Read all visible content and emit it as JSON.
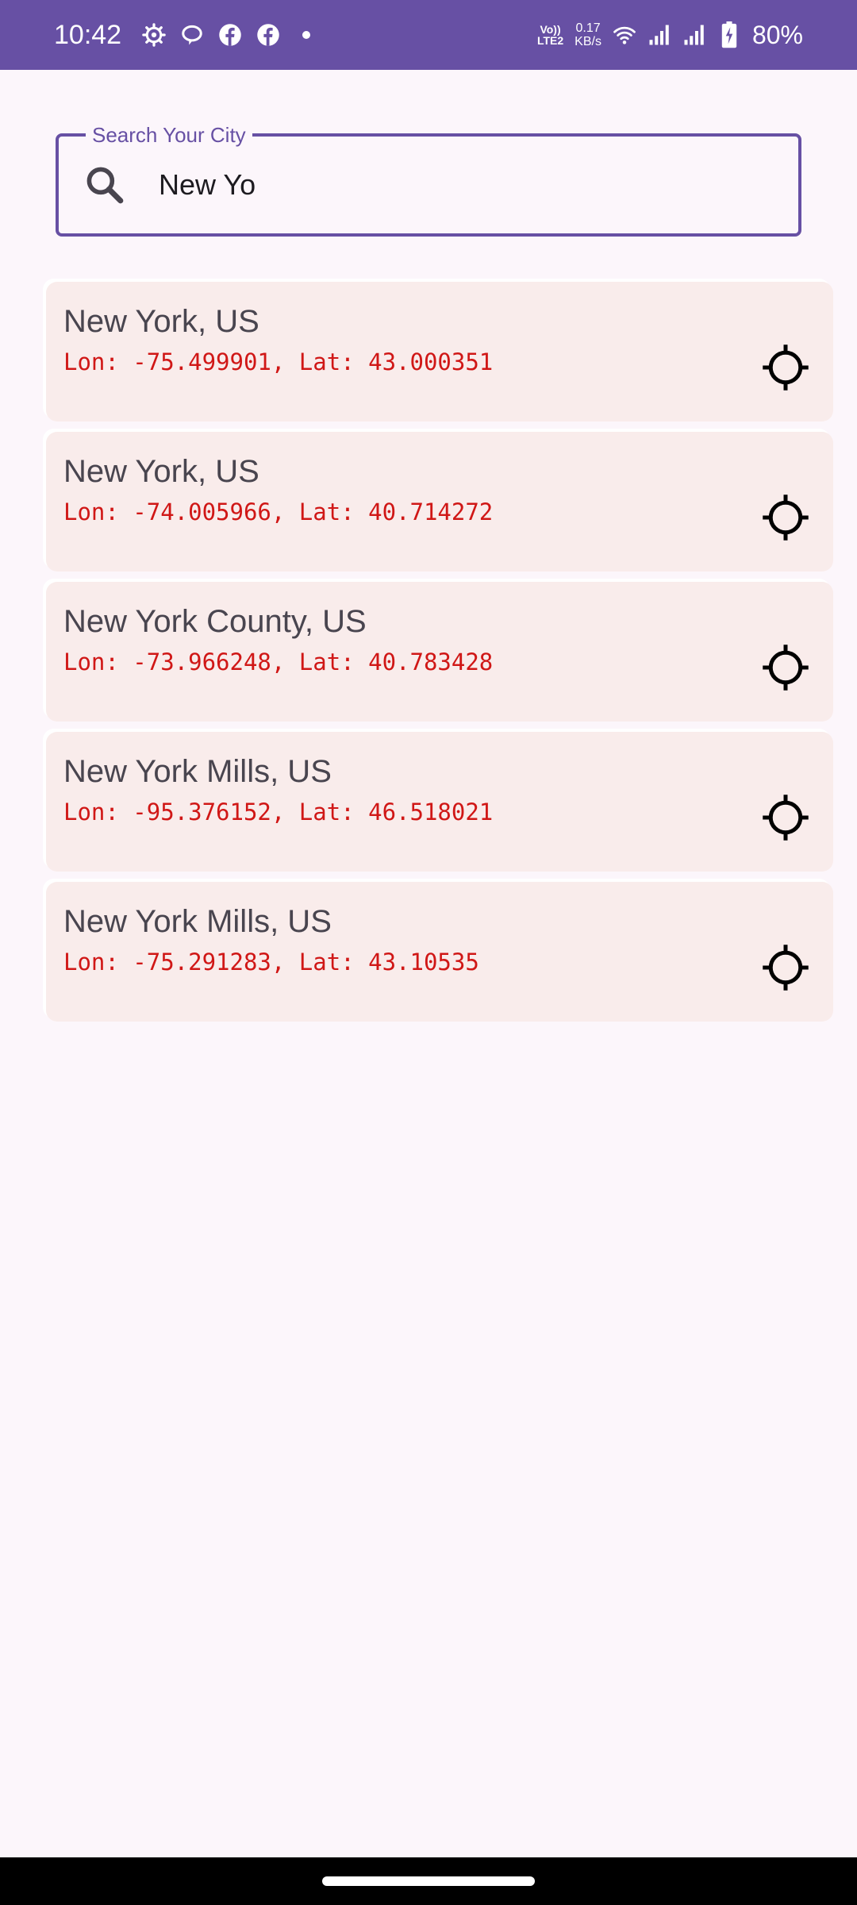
{
  "status_bar": {
    "time": "10:42",
    "icons_left": [
      "settings-icon",
      "chat-bubble-icon",
      "facebook-icon",
      "facebook-icon",
      "dot-icon"
    ],
    "volte_line1": "Vo))",
    "volte_line2": "LTE2",
    "net_speed_value": "0.17",
    "net_speed_unit": "KB/s",
    "icons_right": [
      "wifi-icon",
      "signal-icon",
      "signal-icon",
      "battery-charging-icon"
    ],
    "battery": "80%"
  },
  "search": {
    "label": "Search Your City",
    "value": "New Yo"
  },
  "results": [
    {
      "name": "New York, US",
      "coords": "Lon: -75.499901, Lat: 43.000351"
    },
    {
      "name": "New York, US",
      "coords": "Lon: -74.005966, Lat: 40.714272"
    },
    {
      "name": "New York County, US",
      "coords": "Lon: -73.966248, Lat: 40.783428"
    },
    {
      "name": "New York Mills, US",
      "coords": "Lon: -95.376152, Lat: 46.518021"
    },
    {
      "name": "New York Mills, US",
      "coords": "Lon: -75.291283, Lat: 43.10535"
    }
  ],
  "colors": {
    "primary": "#6750A4",
    "background": "#FCF6FB",
    "card": "#F9ECEB",
    "coords_text": "#D01716"
  }
}
